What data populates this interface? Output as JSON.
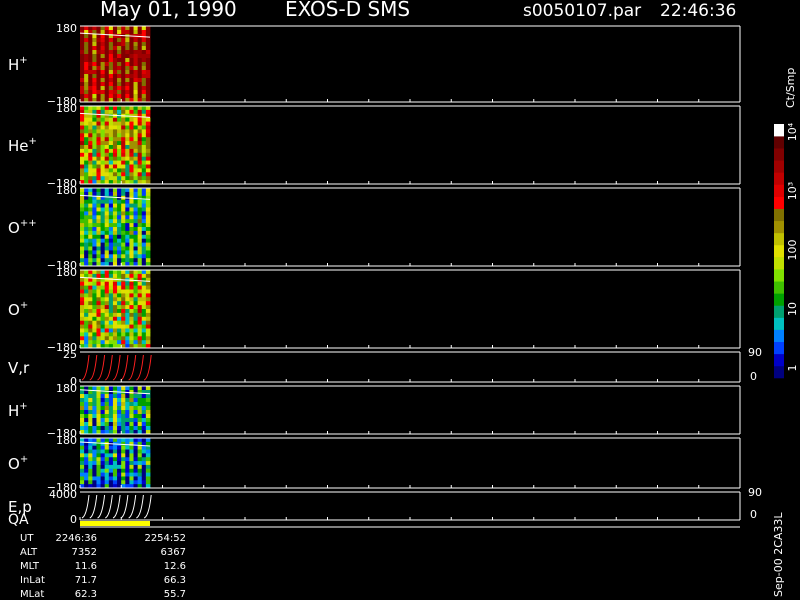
{
  "header": {
    "date": "May 01, 1990",
    "instrument": "EXOS-D SMS",
    "file": "s0050107.par",
    "time": "22:46:36"
  },
  "colorbar": {
    "unit": "Ct/Smp",
    "ticks": [
      "1",
      "10",
      "100",
      "10³",
      "10⁴"
    ],
    "tick_values": [
      1,
      10,
      100,
      1000,
      10000
    ],
    "colors": [
      "#000080",
      "#0000c8",
      "#0040ff",
      "#0080ff",
      "#00c0c0",
      "#00a070",
      "#00a000",
      "#40c000",
      "#80e000",
      "#c0e000",
      "#e0e000",
      "#c0c000",
      "#a09000",
      "#807000",
      "#ff0000",
      "#e00000",
      "#c00000",
      "#a00000",
      "#800000",
      "#600000",
      "#ffffff"
    ]
  },
  "footer": {
    "rows": [
      {
        "label": "UT",
        "values": [
          "2246:36",
          "2254:52"
        ]
      },
      {
        "label": "ALT",
        "values": [
          "7352",
          "6367"
        ]
      },
      {
        "label": "MLT",
        "values": [
          "11.6",
          "12.6"
        ]
      },
      {
        "label": "InLat",
        "values": [
          "71.7",
          "66.3"
        ]
      },
      {
        "label": "MLat",
        "values": [
          "62.3",
          "55.7"
        ]
      }
    ],
    "version": "Sep-00 2CA33L"
  },
  "chart_data": {
    "type": "heatmap",
    "data_span": {
      "from": "2246:36",
      "to": "2254:52"
    },
    "panels": [
      {
        "id": "hplus-1",
        "label": "H",
        "sup": "+",
        "ylim": [
          -180,
          180
        ],
        "ytick_top": "180",
        "ytick_bottom": "−180",
        "kind": "spectrogram",
        "intensity": 0.85,
        "right_ticks": []
      },
      {
        "id": "heplus",
        "label": "He",
        "sup": "+",
        "ylim": [
          -180,
          180
        ],
        "ytick_top": "180",
        "ytick_bottom": "−180",
        "kind": "spectrogram",
        "intensity": 0.55,
        "right_ticks": []
      },
      {
        "id": "oplusplus",
        "label": "O",
        "sup": "++",
        "ylim": [
          -180,
          180
        ],
        "ytick_top": "180",
        "ytick_bottom": "−180",
        "kind": "spectrogram",
        "intensity": 0.3,
        "right_ticks": []
      },
      {
        "id": "oplus-1",
        "label": "O",
        "sup": "+",
        "ylim": [
          -180,
          180
        ],
        "ytick_top": "180",
        "ytick_bottom": "−180",
        "kind": "spectrogram",
        "intensity": 0.5,
        "right_ticks": []
      },
      {
        "id": "vr",
        "label": "V,r",
        "sup": "",
        "ylim": [
          0,
          25
        ],
        "ytick_top": "25",
        "ytick_bottom": "0",
        "kind": "lines",
        "line_color": "#ff2020",
        "right_ticks": [
          "90",
          "0"
        ]
      },
      {
        "id": "hplus-2",
        "label": "H",
        "sup": "+",
        "ylim": [
          -180,
          180
        ],
        "ytick_top": "180",
        "ytick_bottom": "−180",
        "kind": "spectrogram",
        "intensity": 0.28,
        "right_ticks": []
      },
      {
        "id": "oplus-2",
        "label": "O",
        "sup": "+",
        "ylim": [
          -180,
          180
        ],
        "ytick_top": "180",
        "ytick_bottom": "−180",
        "kind": "spectrogram",
        "intensity": 0.18,
        "right_ticks": []
      },
      {
        "id": "ep",
        "label": "E,p",
        "sup": "",
        "ylim": [
          0,
          4000
        ],
        "ytick_top": "4000",
        "ytick_bottom": "0",
        "kind": "lines",
        "line_color": "#ffffff",
        "right_ticks": [
          "90",
          "0"
        ]
      }
    ],
    "qa": {
      "label": "QA",
      "color": "#ffff00"
    }
  }
}
